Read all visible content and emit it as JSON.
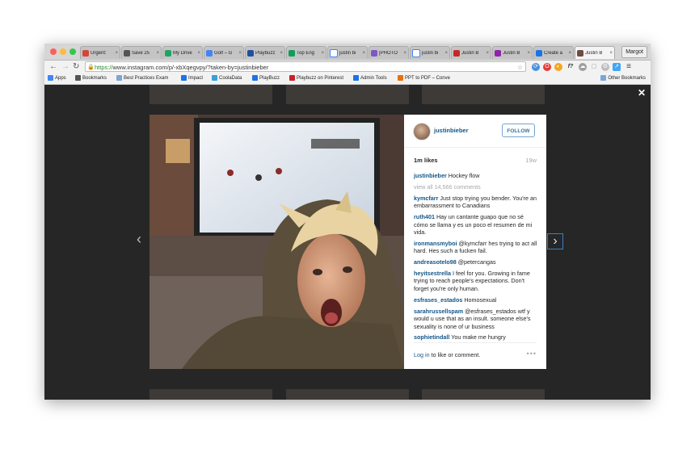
{
  "browser": {
    "tabs": [
      {
        "label": "Urgent: ",
        "fav": "#d44638",
        "icon": "gmail-icon",
        "active": false
      },
      {
        "label": "Save 25",
        "fav": "#555555",
        "icon": "page-icon",
        "active": false
      },
      {
        "label": "My Drive",
        "fav": "#1fa463",
        "icon": "drive-icon",
        "active": false
      },
      {
        "label": "Golf – G",
        "fav": "#4285f4",
        "icon": "docs-icon",
        "active": false
      },
      {
        "label": "Playbuzz",
        "fav": "#1e4fa0",
        "icon": "playbuzz-icon",
        "active": false
      },
      {
        "label": "Top Eng",
        "fav": "#0f9d58",
        "icon": "sheets-icon",
        "active": false
      },
      {
        "label": "justin bi",
        "fav": "#ffffff",
        "icon": "google-icon",
        "active": false
      },
      {
        "label": "[PHOTO",
        "fav": "#7e57c2",
        "icon": "page-icon",
        "active": false
      },
      {
        "label": "justin bi",
        "fav": "#ffffff",
        "icon": "google-icon",
        "active": false
      },
      {
        "label": "Justin B",
        "fav": "#c62828",
        "icon": "page-icon",
        "active": false
      },
      {
        "label": "Justin B",
        "fav": "#8e24aa",
        "icon": "page-icon",
        "active": false
      },
      {
        "label": "Create a",
        "fav": "#1a73e8",
        "icon": "page-icon",
        "active": false
      },
      {
        "label": "Justin B",
        "fav": "#6d4c41",
        "icon": "instagram-icon",
        "active": true
      }
    ],
    "tab_close": "×",
    "profile_name": "Margot",
    "url_scheme": "https://",
    "url_rest": "www.instagram.com/p/-xbXqegvpy/?taken-by=justinbieber",
    "bookmarks": [
      {
        "label": "Apps",
        "color": "#4285f4",
        "icon": "apps-icon"
      },
      {
        "label": "Bookmarks",
        "color": "#555555",
        "icon": "star-icon"
      },
      {
        "label": "Best Practices Exam",
        "color": "#7aa7d8",
        "icon": "folder-icon"
      },
      {
        "label": "Impact",
        "color": "#1a73e8",
        "icon": "globe-icon"
      },
      {
        "label": "CoolaData",
        "color": "#3aa0d8",
        "icon": "page-icon"
      },
      {
        "label": "PlayBuzz",
        "color": "#1a73e8",
        "icon": "globe-icon"
      },
      {
        "label": "Playbuzz on Pinterest",
        "color": "#cb2027",
        "icon": "pinterest-icon"
      },
      {
        "label": "Admin Tools",
        "color": "#1a73e8",
        "icon": "globe-icon"
      },
      {
        "label": "PPT to PDF – Conve",
        "color": "#e8710a",
        "icon": "page-icon"
      }
    ],
    "other_bookmarks": "Other Bookmarks"
  },
  "post": {
    "username": "justinbieber",
    "follow_label": "FOLLOW",
    "likes": "1m likes",
    "age": "19w",
    "caption_user": "justinbieber",
    "caption_text": "Hockey flow",
    "view_all": "view all 14,566 comments",
    "comments": [
      {
        "user": "kymcfarr",
        "text": "Just stop trying you bender. You're an embarrassment to Canadians"
      },
      {
        "user": "ruth401",
        "text": "Hay un cantante guapo que no sé cómo se llama y es un poco el resumen de mi vida."
      },
      {
        "user": "ironmansmyboi",
        "text": "@kymcfarr hes trying to act all hard. Hes such a fucken fail."
      },
      {
        "user": "andreasotelo98",
        "text": "@petercangas"
      },
      {
        "user": "heyitsestrella",
        "text": "I feel for you. Growing in fame trying to reach people's expectations. Don't forget you're only human."
      },
      {
        "user": "esfrases_estados",
        "text": "Homosexual"
      },
      {
        "user": "sarahrussellspam",
        "text": "@esfrases_estados wtf y would u use that as an insult. someone else's sexuality is none of ur business"
      },
      {
        "user": "sophietindall",
        "text": "You make me hungry"
      }
    ],
    "login_link": "Log in",
    "login_text": " to like or comment.",
    "more": "•••"
  },
  "modal": {
    "close": "✕",
    "prev": "‹",
    "next": "›"
  }
}
